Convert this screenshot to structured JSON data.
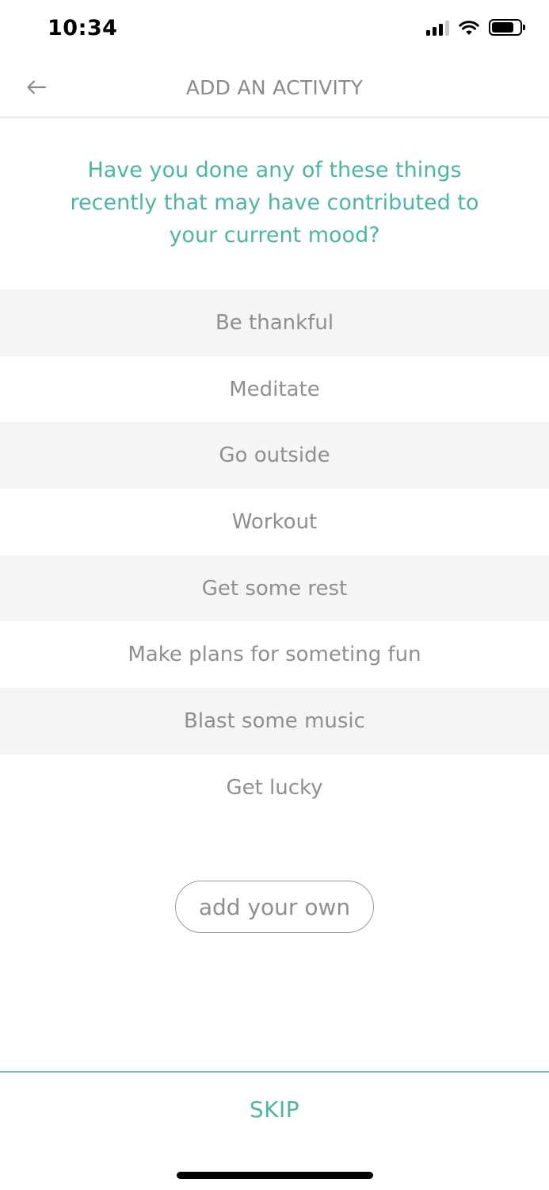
{
  "status_bar": {
    "time": "10:34",
    "signal_icon": "cellular-signal-icon",
    "wifi_icon": "wifi-icon",
    "battery_icon": "battery-icon"
  },
  "header": {
    "back_icon": "arrow-left-icon",
    "title": "ADD AN ACTIVITY"
  },
  "question": "Have you done any of these things recently that may have contributed to your current mood?",
  "activities": [
    {
      "label": "Be thankful"
    },
    {
      "label": "Meditate"
    },
    {
      "label": "Go outside"
    },
    {
      "label": "Workout"
    },
    {
      "label": "Get some rest"
    },
    {
      "label": "Make plans for someting fun"
    },
    {
      "label": "Blast some music"
    },
    {
      "label": "Get lucky"
    }
  ],
  "add_own_label": "add your own",
  "skip_label": "SKIP",
  "colors": {
    "accent": "#4db6a2",
    "row_shade": "#f5f5f5",
    "text_gray": "#8f8f8f"
  }
}
